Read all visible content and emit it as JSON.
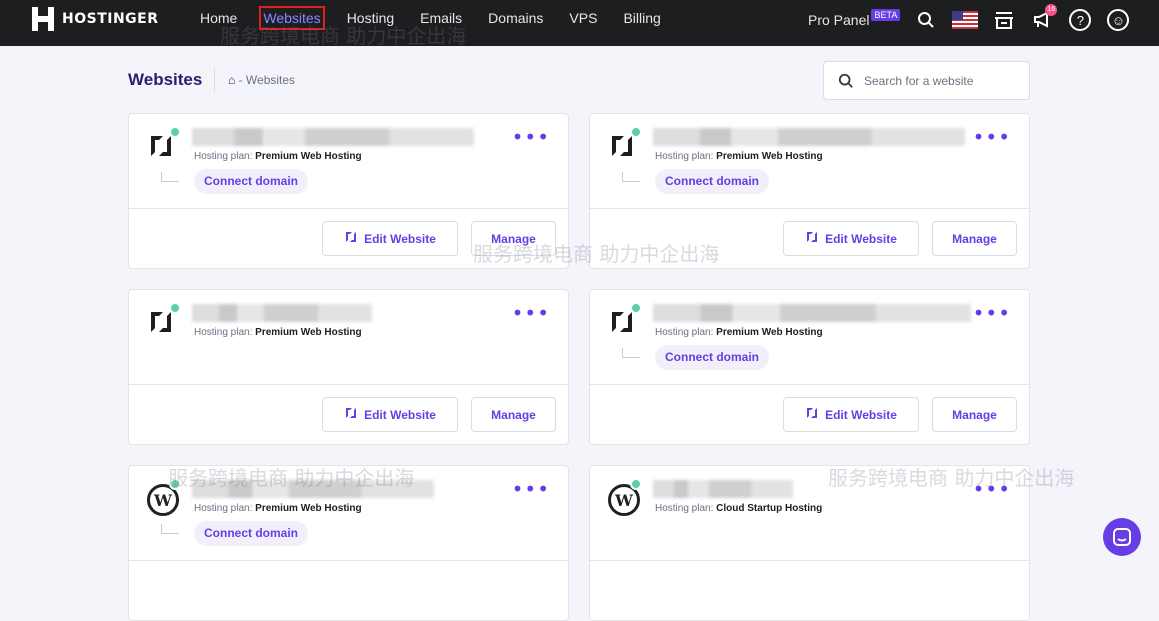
{
  "topbar": {
    "brand": "HOSTINGER",
    "nav": [
      "Home",
      "Websites",
      "Hosting",
      "Emails",
      "Domains",
      "VPS",
      "Billing"
    ],
    "active": "Websites",
    "pro_panel": "Pro Panel",
    "beta": "BETA",
    "notif_count": "16"
  },
  "page": {
    "title": "Websites",
    "breadcrumb": "- Websites",
    "search_placeholder": "Search for a website"
  },
  "cards": [
    {
      "plan_label": "Hosting plan:",
      "plan": "Premium Web Hosting",
      "connect": "Connect domain",
      "edit": "Edit Website",
      "manage": "Manage",
      "type": "hostinger"
    },
    {
      "plan_label": "Hosting plan:",
      "plan": "Premium Web Hosting",
      "connect": "Connect domain",
      "edit": "Edit Website",
      "manage": "Manage",
      "type": "hostinger"
    },
    {
      "plan_label": "Hosting plan:",
      "plan": "Premium Web Hosting",
      "edit": "Edit Website",
      "manage": "Manage",
      "type": "hostinger"
    },
    {
      "plan_label": "Hosting plan:",
      "plan": "Premium Web Hosting",
      "connect": "Connect domain",
      "edit": "Edit Website",
      "manage": "Manage",
      "type": "hostinger"
    },
    {
      "plan_label": "Hosting plan:",
      "plan": "Premium Web Hosting",
      "connect": "Connect domain",
      "type": "wordpress"
    },
    {
      "plan_label": "Hosting plan:",
      "plan": "Cloud Startup Hosting",
      "type": "wordpress"
    }
  ],
  "watermark": "服务跨境电商 助力中企出海",
  "colors": {
    "accent": "#673de6",
    "topbar": "#1d1e20"
  }
}
